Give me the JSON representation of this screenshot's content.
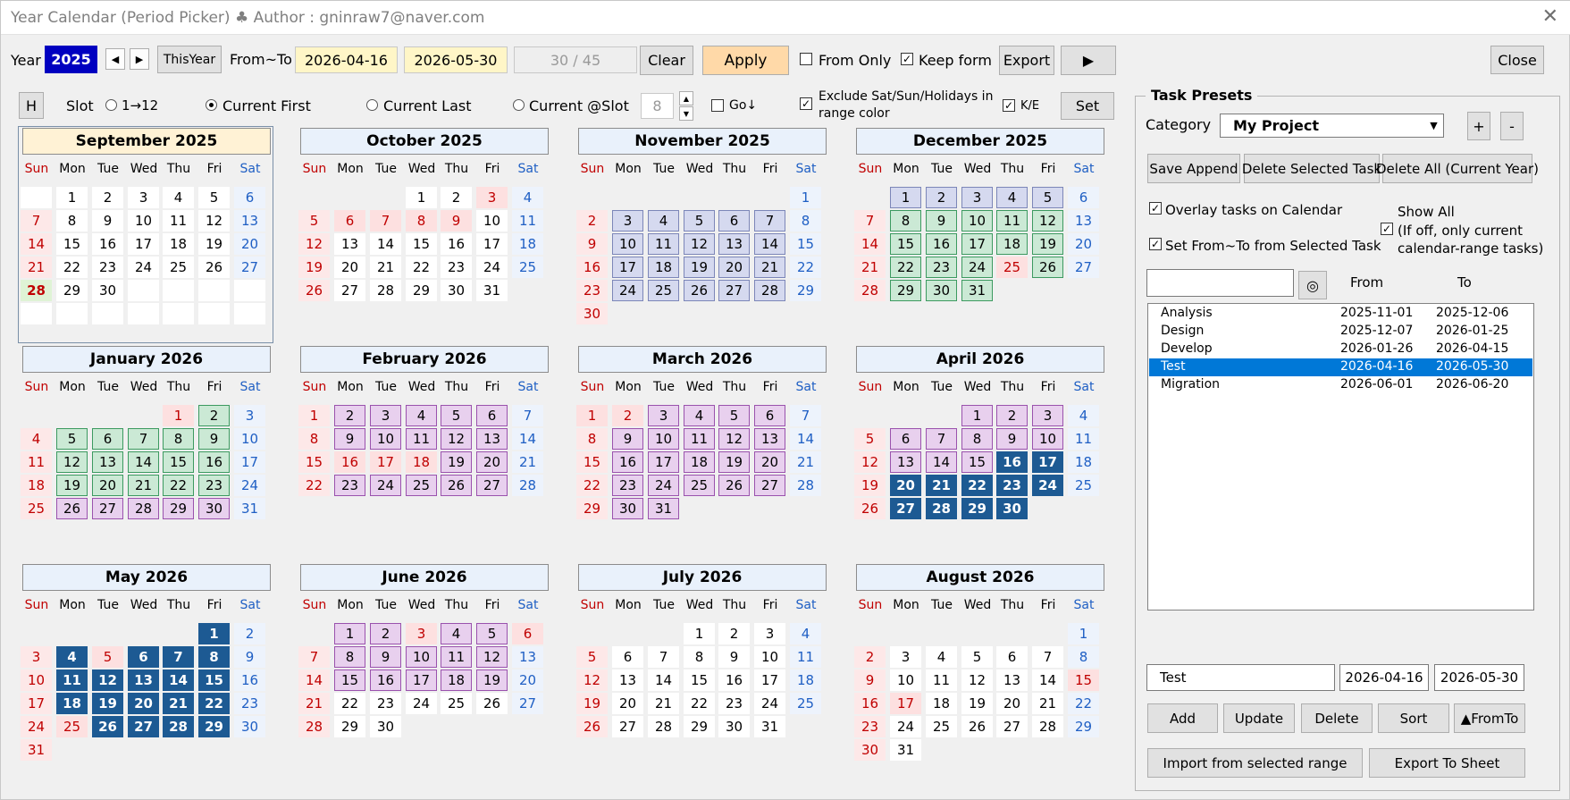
{
  "window": {
    "title": "Year Calendar (Period Picker) ♣ Author :  gninraw7@naver.com",
    "close_glyph": "✕"
  },
  "toolbar": {
    "year_label": "Year",
    "year_value": "2025",
    "prev_glyph": "◀",
    "next_glyph": "▶",
    "this_year": "ThisYear",
    "fromto_label": "From~To",
    "from_value": "2026-04-16",
    "to_value": "2026-05-30",
    "count_value": "30 / 45",
    "clear": "Clear",
    "apply": "Apply",
    "from_only": "From Only",
    "keep_form": "Keep form",
    "export": "Export",
    "play_glyph": "▶",
    "close": "Close"
  },
  "options": {
    "h_button": "H",
    "slot_label": "Slot",
    "slot_1_12": "1→12",
    "current_first": "Current First",
    "current_last": "Current Last",
    "current_at_slot": "Current @Slot",
    "slot_value": "8",
    "go_down": "Go↓",
    "exclude_line1": "Exclude Sat/Sun/Holidays in",
    "exclude_line2": "range color",
    "ke": "K/E",
    "set": "Set",
    "checkmark": "✓"
  },
  "weekdays": [
    "Sun",
    "Mon",
    "Tue",
    "Wed",
    "Thu",
    "Fri",
    "Sat"
  ],
  "months": [
    {
      "title": "September 2025",
      "start": 1,
      "days": 30,
      "current": true,
      "holidays": [],
      "today": 28,
      "tasks": []
    },
    {
      "title": "October 2025",
      "start": 3,
      "days": 31,
      "holidays": [
        3,
        6,
        7,
        8,
        9
      ],
      "tasks": []
    },
    {
      "title": "November 2025",
      "start": 6,
      "days": 30,
      "holidays": [],
      "tasks": [
        {
          "name": "Analysis",
          "from": 3,
          "to": 28
        }
      ]
    },
    {
      "title": "December 2025",
      "start": 1,
      "days": 31,
      "holidays": [
        25
      ],
      "tasks": [
        {
          "name": "Analysis",
          "from": 1,
          "to": 5
        },
        {
          "name": "Design",
          "from": 8,
          "to": 31
        }
      ]
    },
    {
      "title": "January 2026",
      "start": 4,
      "days": 31,
      "holidays": [
        1
      ],
      "tasks": [
        {
          "name": "Design",
          "from": 2,
          "to": 23
        },
        {
          "name": "Develop",
          "from": 26,
          "to": 30
        }
      ]
    },
    {
      "title": "February 2026",
      "start": 0,
      "days": 28,
      "holidays": [
        16,
        17,
        18
      ],
      "tasks": [
        {
          "name": "Develop",
          "from": 2,
          "to": 27
        }
      ]
    },
    {
      "title": "March 2026",
      "start": 0,
      "days": 31,
      "holidays": [
        1,
        2
      ],
      "tasks": [
        {
          "name": "Develop",
          "from": 2,
          "to": 31
        }
      ]
    },
    {
      "title": "April 2026",
      "start": 3,
      "days": 30,
      "holidays": [],
      "tasks": [
        {
          "name": "Develop",
          "from": 1,
          "to": 15
        },
        {
          "name": "Test",
          "from": 16,
          "to": 30
        }
      ]
    },
    {
      "title": "May 2026",
      "start": 5,
      "days": 31,
      "holidays": [
        5,
        25
      ],
      "tasks": [
        {
          "name": "Test",
          "from": 1,
          "to": 29
        }
      ]
    },
    {
      "title": "June 2026",
      "start": 1,
      "days": 30,
      "holidays": [
        3,
        6
      ],
      "tasks": [
        {
          "name": "Migration",
          "from": 1,
          "to": 19
        }
      ]
    },
    {
      "title": "July 2026",
      "start": 3,
      "days": 31,
      "holidays": [],
      "tasks": []
    },
    {
      "title": "August 2026",
      "start": 6,
      "days": 31,
      "holidays": [
        15,
        17
      ],
      "tasks": []
    }
  ],
  "presets": {
    "group_title": "Task Presets",
    "category_label": "Category",
    "category_value": "My Project",
    "dropdown_glyph": "▼",
    "plus": "+",
    "minus": "-",
    "save_append": "Save Append",
    "delete_selected": "Delete Selected Task",
    "delete_all": "Delete All (Current Year)",
    "overlay": "Overlay tasks on Calendar",
    "set_fromto": "Set From~To from Selected Task",
    "show_all_1": "Show All",
    "show_all_2": "(If off, only current",
    "show_all_3": "calendar-range tasks)",
    "search_value": "",
    "search_glyph": "◎",
    "col_from": "From",
    "col_to": "To",
    "tasks": [
      {
        "name": "Analysis",
        "from": "2025-11-01",
        "to": "2025-12-06"
      },
      {
        "name": "Design",
        "from": "2025-12-07",
        "to": "2026-01-25"
      },
      {
        "name": "Develop",
        "from": "2026-01-26",
        "to": "2026-04-15"
      },
      {
        "name": "Test",
        "from": "2026-04-16",
        "to": "2026-05-30"
      },
      {
        "name": "Migration",
        "from": "2026-06-01",
        "to": "2026-06-20"
      }
    ],
    "selected_index": 3,
    "edit_name": "Test",
    "edit_from": "2026-04-16",
    "edit_to": "2026-05-30",
    "add": "Add",
    "update": "Update",
    "delete": "Delete",
    "sort": "Sort",
    "fromto": "▲FromTo",
    "import": "Import from selected range",
    "export_sheet": "Export To Sheet"
  },
  "colors": {
    "year_bg": "#0000c0",
    "apply_bg": "#ffd9a8",
    "date_bg": "#fff6c7",
    "test_task": "#1d5a93",
    "select": "#0078d7"
  }
}
